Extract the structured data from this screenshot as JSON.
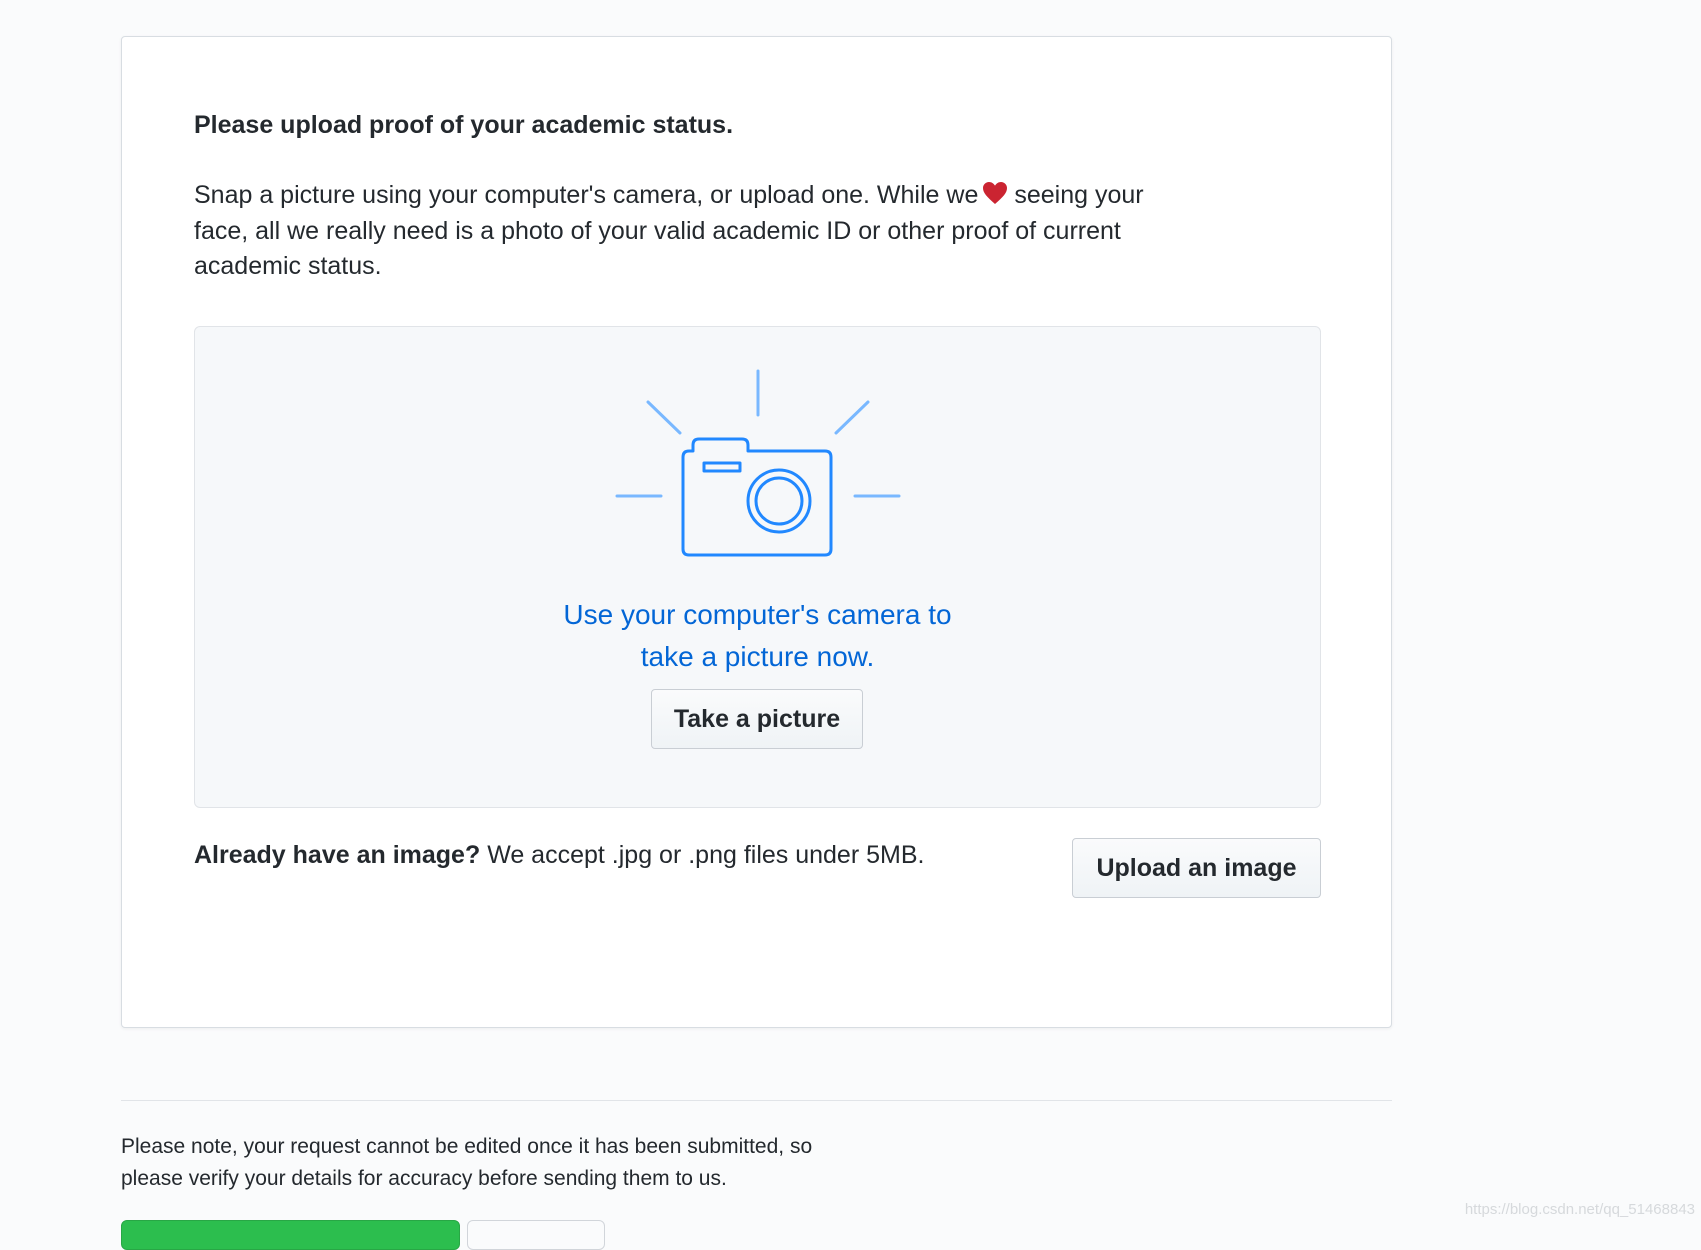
{
  "card": {
    "heading": "Please upload proof of your academic status.",
    "intro_before_heart": "Snap a picture using your computer's camera, or upload one. While we",
    "intro_after_heart": "seeing your face, all we really need is a photo of your valid academic ID or other proof of current academic status."
  },
  "camera_panel": {
    "caption_line1": "Use your computer's camera to",
    "caption_line2": "take a picture now.",
    "take_picture_label": "Take a picture"
  },
  "upload": {
    "bold_text": "Already have an image?",
    "text": "We accept .jpg or .png files under 5MB.",
    "button_label": "Upload an image"
  },
  "footer": {
    "note": "Please note, your request cannot be edited once it has been submitted, so please verify your details for accuracy before sending them to us."
  },
  "watermark": "https://blog.csdn.net/qq_51468843",
  "colors": {
    "link_blue": "#0366d6",
    "camera_blue": "#2188ff",
    "heart_red": "#cb2431",
    "submit_green": "#2cbe4e"
  },
  "icons": {
    "camera": "camera-icon",
    "heart": "heart-icon"
  }
}
